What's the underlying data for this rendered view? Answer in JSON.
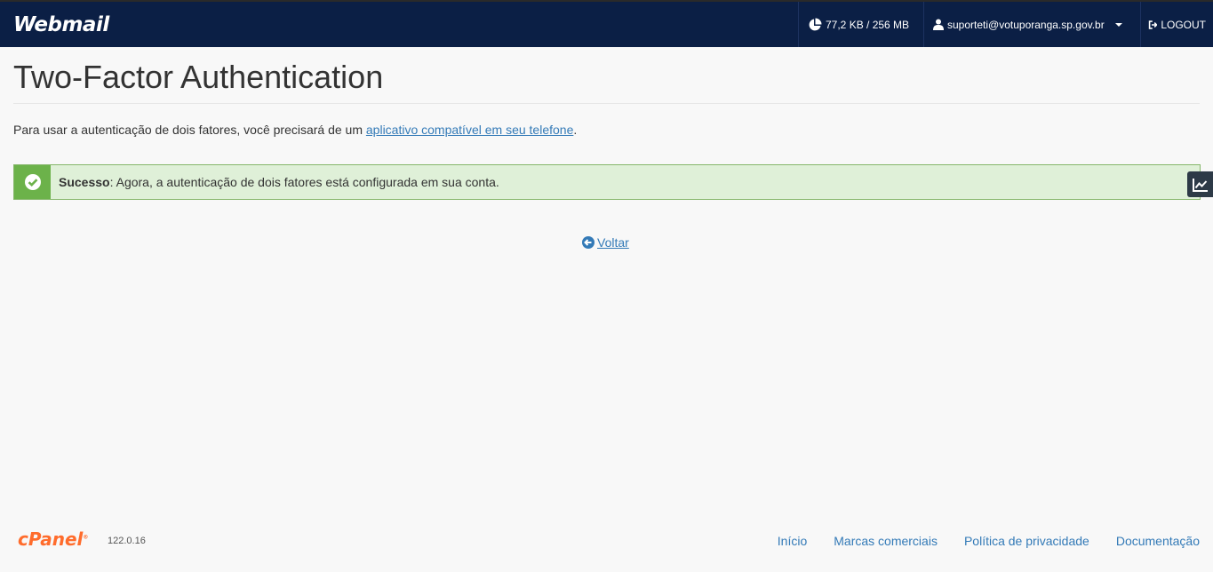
{
  "header": {
    "logo": "Webmail",
    "disk_usage": "77,2 KB / 256 MB",
    "user_email": "suporteti@votuporanga.sp.gov.br",
    "logout_label": "LOGOUT"
  },
  "main": {
    "title": "Two-Factor Authentication",
    "intro_text": "Para usar a autenticação de dois fatores, você precisará de um ",
    "intro_link": "aplicativo compatível em seu telefone",
    "intro_end": ".",
    "alert": {
      "label": "Sucesso",
      "message": ": Agora, a autenticação de dois fatores está configurada em sua conta."
    },
    "back_label": "Voltar"
  },
  "footer": {
    "logo": "cPanel",
    "version": "122.0.16",
    "links": [
      "Início",
      "Marcas comerciais",
      "Política de privacidade",
      "Documentação"
    ]
  },
  "colors": {
    "header_bg": "#0b1f45",
    "link": "#337ab7",
    "success_bg": "#dff0d8",
    "success_accent": "#6cb24a",
    "cpanel_orange": "#ff6c2c"
  }
}
